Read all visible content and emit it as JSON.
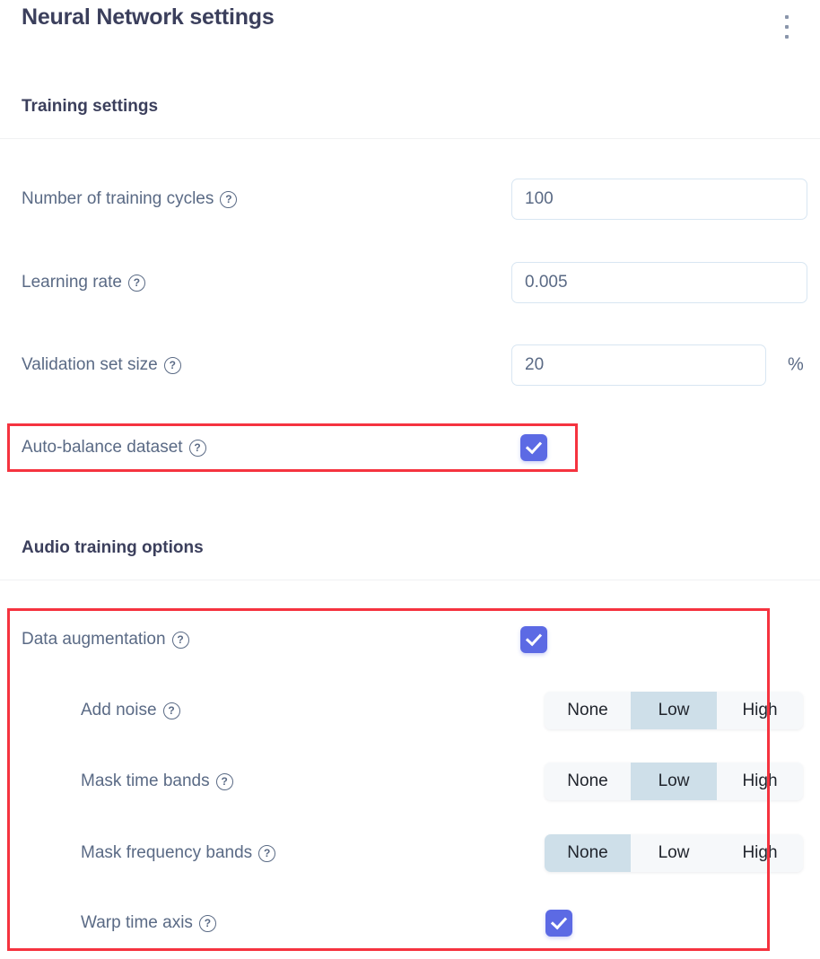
{
  "header": {
    "title": "Neural Network settings",
    "menu_icon": "kebab-menu-icon"
  },
  "sections": [
    {
      "id": "training",
      "heading": "Training settings"
    },
    {
      "id": "audio",
      "heading": "Audio training options"
    }
  ],
  "training_settings": {
    "rows": [
      {
        "id": "training-cycles",
        "label": "Number of training cycles",
        "help_icon": "help-circle-icon",
        "control": "text-input",
        "value": "100"
      },
      {
        "id": "learning-rate",
        "label": "Learning rate",
        "help_icon": "help-circle-icon",
        "control": "text-input",
        "value": "0.005"
      },
      {
        "id": "validation-set-size",
        "label": "Validation set size",
        "help_icon": "help-circle-icon",
        "control": "text-input",
        "value": "20",
        "unit": "%"
      },
      {
        "id": "auto-balance-dataset",
        "label": "Auto-balance dataset",
        "help_icon": "help-circle-icon",
        "control": "checkbox",
        "checked": true,
        "highlighted": true
      }
    ]
  },
  "audio_training_options": {
    "rows": [
      {
        "id": "data-augmentation",
        "label": "Data augmentation",
        "help_icon": "help-circle-icon",
        "control": "checkbox",
        "checked": true
      },
      {
        "id": "add-noise",
        "label": "Add noise",
        "help_icon": "help-circle-icon",
        "control": "segmented",
        "options": [
          "None",
          "Low",
          "High"
        ],
        "selected": "Low"
      },
      {
        "id": "mask-time-bands",
        "label": "Mask time bands",
        "help_icon": "help-circle-icon",
        "control": "segmented",
        "options": [
          "None",
          "Low",
          "High"
        ],
        "selected": "Low"
      },
      {
        "id": "mask-frequency-bands",
        "label": "Mask frequency bands",
        "help_icon": "help-circle-icon",
        "control": "segmented",
        "options": [
          "None",
          "Low",
          "High"
        ],
        "selected": "None"
      },
      {
        "id": "warp-time-axis",
        "label": "Warp time axis",
        "help_icon": "help-circle-icon",
        "control": "checkbox",
        "checked": true
      }
    ]
  },
  "colors": {
    "accent": "#5c6ae4",
    "highlight_border": "#f5333f",
    "heading_text": "#3b3f5c",
    "label_text": "#5a6a85",
    "input_border": "#d8e6f2",
    "segment_bg": "#f6f8fa",
    "segment_selected_bg": "#cedfe9"
  }
}
